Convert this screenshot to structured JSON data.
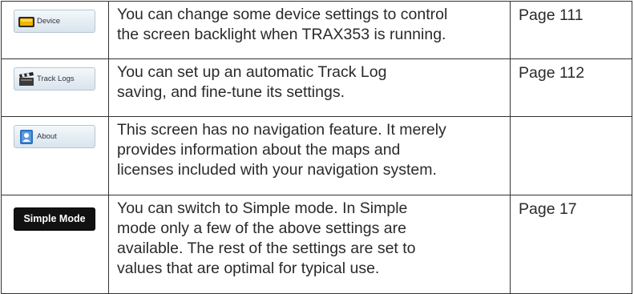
{
  "rows": [
    {
      "button_label": "Device",
      "button_icon": "device-icon",
      "description_lines": [
        "You can change some device settings to control",
        "the screen backlight when TRAX353 is running."
      ],
      "page": "Page 111"
    },
    {
      "button_label": "Track Logs",
      "button_icon": "clapperboard-icon",
      "description_lines": [
        "You can set up an automatic Track Log",
        "saving, and fine-tune its settings."
      ],
      "page": "Page 112"
    },
    {
      "button_label": "About",
      "button_icon": "user-info-icon",
      "description_lines": [
        "This screen has no navigation feature. It merely",
        "provides information about the maps and",
        "licenses included with your navigation system."
      ],
      "page": ""
    },
    {
      "button_label": "Simple Mode",
      "button_icon": "",
      "description_lines": [
        "You can switch to Simple mode. In Simple",
        "mode only a few of the above settings are",
        "available. The rest of the settings are set to",
        "values that are optimal for typical use."
      ],
      "page": "Page 17"
    }
  ],
  "colors": {
    "border": "#333333",
    "text": "#2a2a2a",
    "simple_mode_bg": "#111111"
  }
}
